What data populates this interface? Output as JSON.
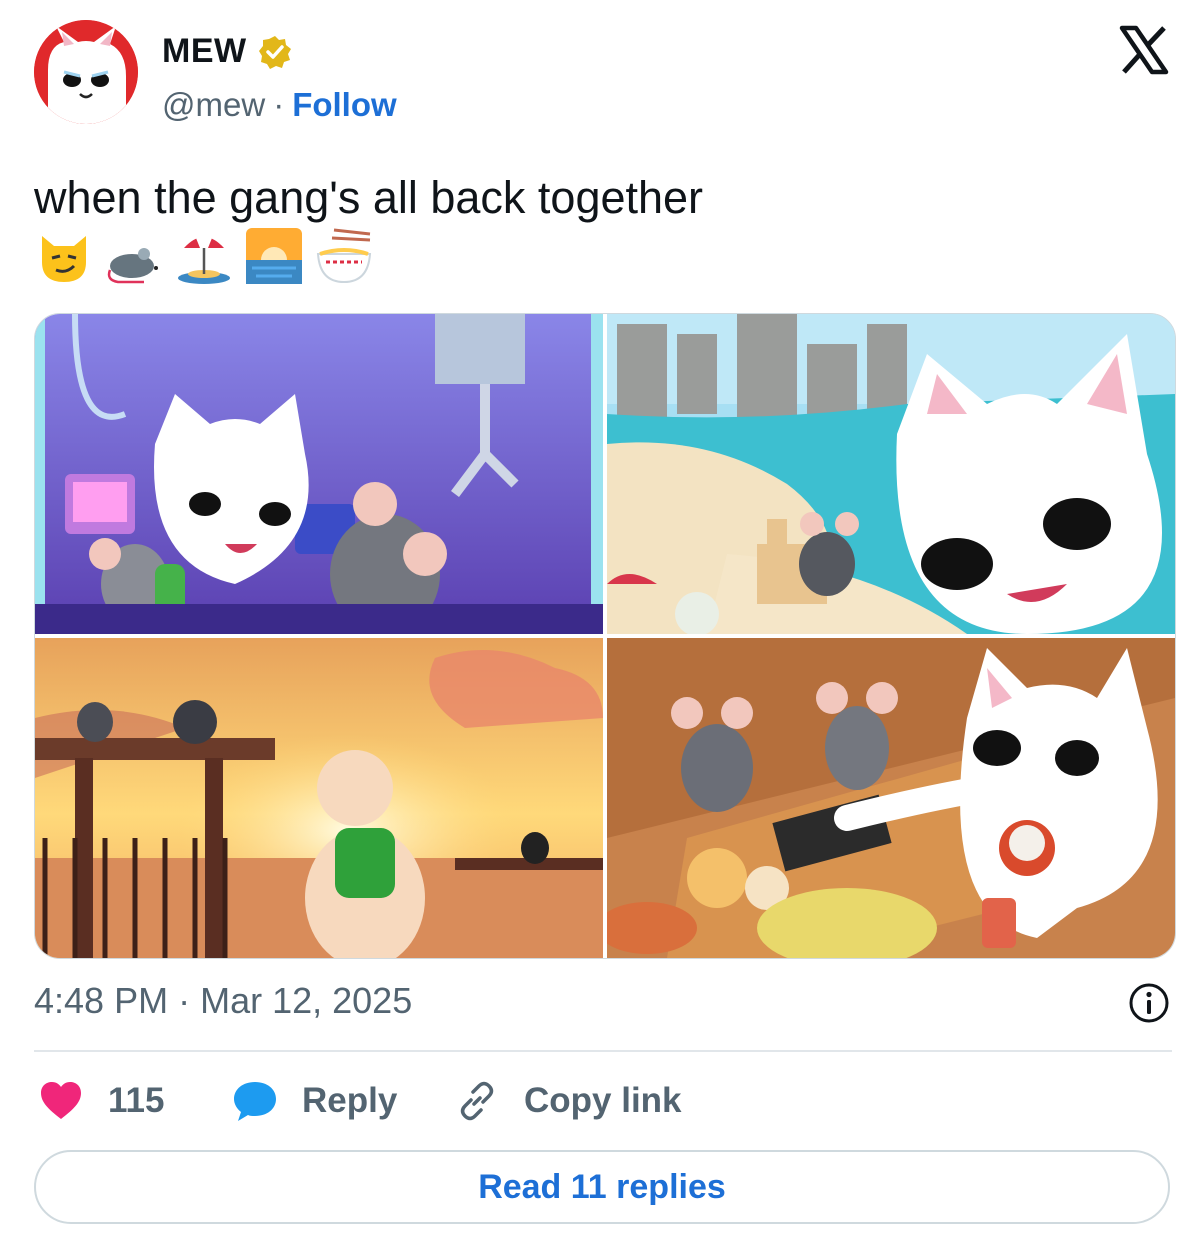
{
  "author": {
    "name": "MEW",
    "handle": "@mew",
    "separator": "·",
    "follow_label": "Follow",
    "verified": true,
    "badge_color": "#e2b719",
    "avatar_color": "#e0292b"
  },
  "tweet": {
    "text": "when the gang's all back together",
    "emojis": [
      "smirking-cat-icon",
      "rat-icon",
      "beach-umbrella-icon",
      "sunrise-icon",
      "ramen-icon"
    ]
  },
  "media": {
    "images": [
      {
        "name": "arcade-claw-machine-image"
      },
      {
        "name": "beach-sandcastle-image"
      },
      {
        "name": "sunset-pier-image"
      },
      {
        "name": "hotpot-dinner-image"
      }
    ]
  },
  "meta": {
    "time": "4:48 PM",
    "separator": "·",
    "date": "Mar 12, 2025"
  },
  "actions": {
    "like_count": "115",
    "reply_label": "Reply",
    "copy_label": "Copy link"
  },
  "read_replies_label": "Read 11 replies",
  "colors": {
    "accent": "#1d6fd6",
    "like": "#f0267a",
    "reply_icon": "#1d9bf0",
    "muted": "#536471"
  }
}
